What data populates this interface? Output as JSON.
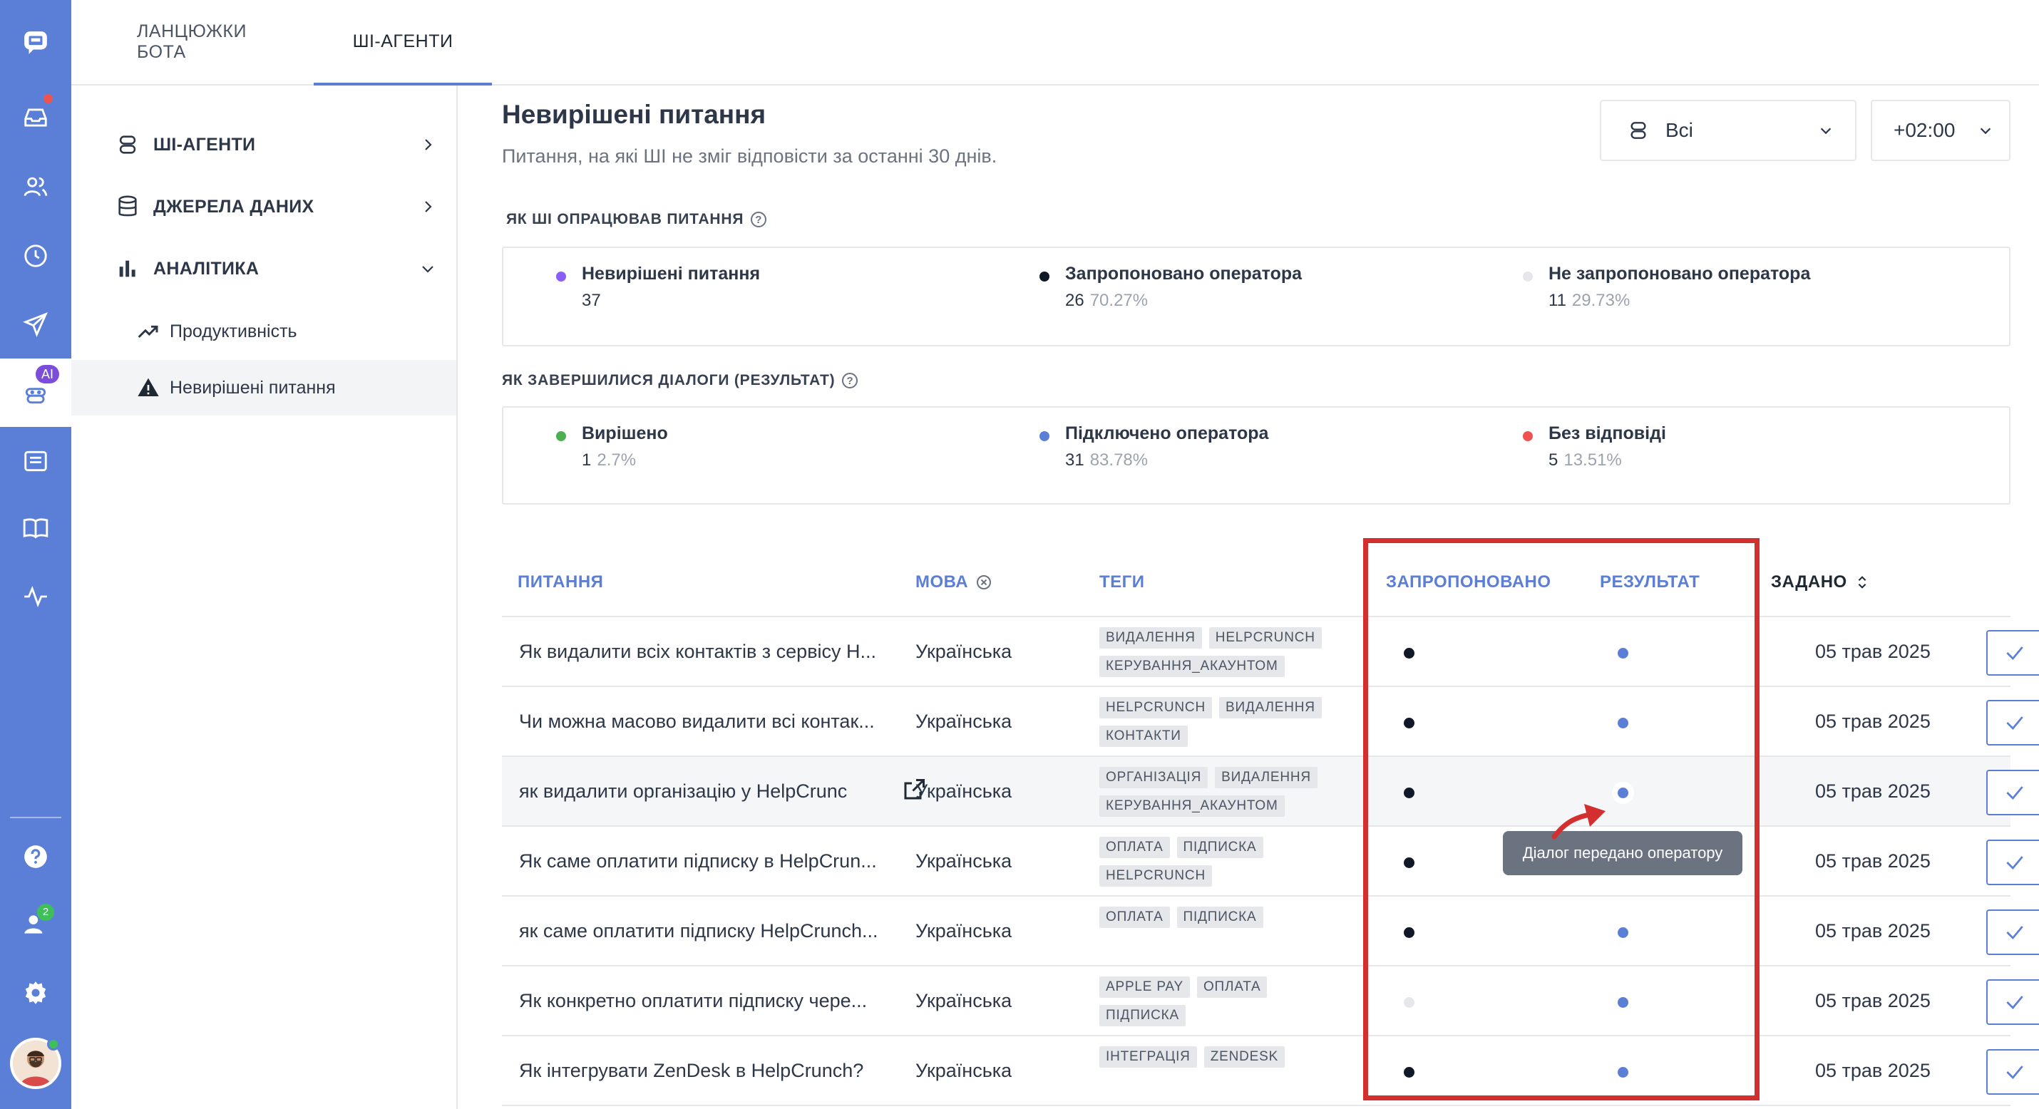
{
  "tabs": [
    {
      "label": "ЛАНЦЮЖКИ БОТА"
    },
    {
      "label": "ШІ-АГЕНТИ"
    }
  ],
  "rail": {
    "ai_badge": "AI",
    "team_badge": "2"
  },
  "sidebar": {
    "items": [
      {
        "label": "ШІ-АГЕНТИ",
        "icon": "bot-icon"
      },
      {
        "label": "ДЖЕРЕЛА ДАНИХ",
        "icon": "database-icon"
      },
      {
        "label": "АНАЛІТИКА",
        "icon": "bar-chart-icon"
      }
    ],
    "subitems": [
      {
        "label": "Продуктивність",
        "icon": "trend-icon"
      },
      {
        "label": "Невирішені питання",
        "icon": "warning-icon"
      }
    ]
  },
  "header": {
    "title": "Невирішені питання",
    "subtitle": "Питання, на які ШІ не зміг відповісти за останні 30 днів.",
    "agent_filter": "Всі",
    "timezone": "+02:00"
  },
  "processing": {
    "label": "ЯК ШІ ОПРАЦЮВАВ ПИТАННЯ",
    "stats": [
      {
        "name": "Невирішені питання",
        "count": "37",
        "pct": "",
        "color": "#8b5cf6"
      },
      {
        "name": "Запропоновано оператора",
        "count": "26",
        "pct": "70.27%",
        "color": "#111827"
      },
      {
        "name": "Не запропоновано оператора",
        "count": "11",
        "pct": "29.73%",
        "color": "#e5e7eb"
      }
    ]
  },
  "results": {
    "label": "ЯК ЗАВЕРШИЛИСЯ ДІАЛОГИ (РЕЗУЛЬТАТ)",
    "stats": [
      {
        "name": "Вирішено",
        "count": "1",
        "pct": "2.7%",
        "color": "#4caf50"
      },
      {
        "name": "Підключено оператора",
        "count": "31",
        "pct": "83.78%",
        "color": "#5b7fd6"
      },
      {
        "name": "Без відповіді",
        "count": "5",
        "pct": "13.51%",
        "color": "#ef5350"
      }
    ]
  },
  "table": {
    "columns": {
      "question": "ПИТАННЯ",
      "language": "МОВА",
      "tags": "ТЕГИ",
      "suggested": "ЗАПРОПОНОВАНО",
      "result": "РЕЗУЛЬТАТ",
      "asked": "ЗАДАНО"
    },
    "rows": [
      {
        "question": "Як видалити всіх контактів з сервісу H...",
        "language": "Українська",
        "tags": [
          "ВИДАЛЕННЯ",
          "HELPCRUNCH",
          "КЕРУВАННЯ_АКАУНТОМ"
        ],
        "suggested": "#111827",
        "date": "05 трав 2025"
      },
      {
        "question": "Чи можна масово видалити всі контак...",
        "language": "Українська",
        "tags": [
          "HELPCRUNCH",
          "ВИДАЛЕННЯ",
          "КОНТАКТИ"
        ],
        "suggested": "#111827",
        "date": "05 трав 2025"
      },
      {
        "question": "як видалити організацію у HelpCrunc",
        "language": "Українська",
        "tags": [
          "ОРГАНІЗАЦІЯ",
          "ВИДАЛЕННЯ",
          "КЕРУВАННЯ_АКАУНТОМ"
        ],
        "suggested": "#111827",
        "date": "05 трав 2025"
      },
      {
        "question": "Як саме оплатити підписку в HelpCrun...",
        "language": "Українська",
        "tags": [
          "ОПЛАТА",
          "ПІДПИСКА",
          "HELPCRUNCH"
        ],
        "suggested": "#111827",
        "date": "05 трав 2025"
      },
      {
        "question": "як саме оплатити підписку HelpCrunch...",
        "language": "Українська",
        "tags": [
          "ОПЛАТА",
          "ПІДПИСКА"
        ],
        "suggested": "#111827",
        "date": "05 трав 2025"
      },
      {
        "question": "Як конкретно оплатити підписку чере...",
        "language": "Українська",
        "tags": [
          "APPLE PAY",
          "ОПЛАТА",
          "ПІДПИСКА"
        ],
        "suggested": "#e5e7eb",
        "date": "05 трав 2025"
      },
      {
        "question": "Як інтегрувати ZenDesk в HelpCrunch?",
        "language": "Українська",
        "tags": [
          "ІНТЕГРАЦІЯ",
          "ZENDESK"
        ],
        "suggested": "#111827",
        "date": "05 трав 2025"
      }
    ]
  },
  "tooltip": "Діалог передано оператору"
}
